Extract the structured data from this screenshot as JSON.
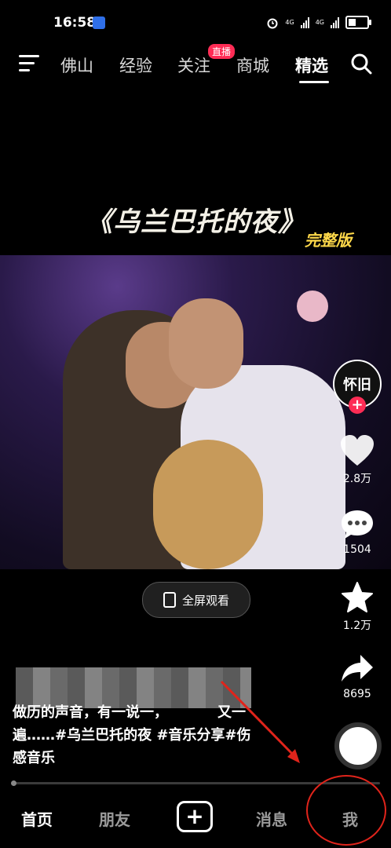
{
  "status_bar": {
    "time": "16:58",
    "network1": "4G",
    "network2": "4G"
  },
  "top_nav": {
    "tabs": [
      {
        "label": "佛山"
      },
      {
        "label": "经验"
      },
      {
        "label": "关注"
      },
      {
        "label": "商城"
      },
      {
        "label": "精选"
      }
    ],
    "active_tab": "精选",
    "live_badge": "直播"
  },
  "video": {
    "title": "《乌兰巴托的夜》",
    "subtitle": "完整版",
    "fullscreen_label": "全屏观看"
  },
  "rail": {
    "avatar_text": "怀旧",
    "likes": "2.8万",
    "comments": "1504",
    "favorites": "1.2万",
    "shares": "8695"
  },
  "caption": {
    "line1": "做历的声音，有一说一，　　　　又一",
    "line2": "遍……#乌兰巴托的夜 #音乐分享#伤",
    "line3": "感音乐"
  },
  "bottom_nav": {
    "home": "首页",
    "friends": "朋友",
    "add": "+",
    "messages": "消息",
    "me": "我"
  },
  "colors": {
    "accent_red": "#fe2c55",
    "annotation_red": "#e0241b",
    "subtitle_gold": "#ffd94a"
  }
}
